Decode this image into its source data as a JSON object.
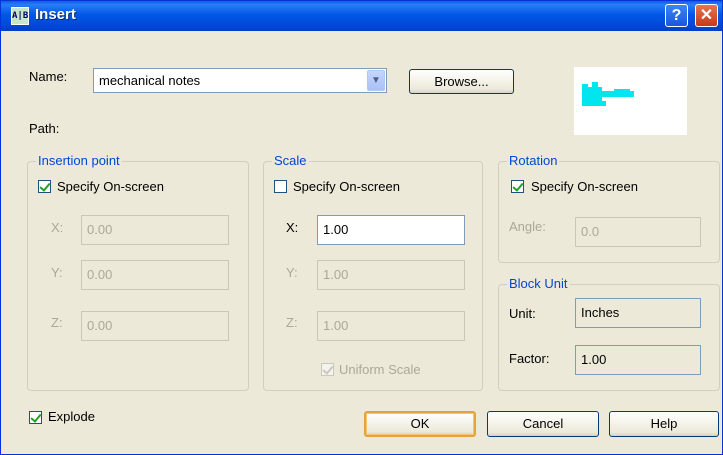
{
  "window": {
    "title": "Insert",
    "help_glyph": "?",
    "close_glyph": "✕",
    "icon_text": "A|B"
  },
  "name_row": {
    "label": "Name:",
    "value": "mechanical notes",
    "browse_label": "Browse..."
  },
  "path": {
    "label": "Path:"
  },
  "insertion_point": {
    "title": "Insertion point",
    "specify_label": "Specify On-screen",
    "specify_checked": true,
    "x_label": "X:",
    "x_value": "0.00",
    "y_label": "Y:",
    "y_value": "0.00",
    "z_label": "Z:",
    "z_value": "0.00"
  },
  "scale": {
    "title": "Scale",
    "specify_label": "Specify On-screen",
    "specify_checked": false,
    "x_label": "X:",
    "x_value": "1.00",
    "y_label": "Y:",
    "y_value": "1.00",
    "z_label": "Z:",
    "z_value": "1.00",
    "uniform_label": "Uniform Scale",
    "uniform_checked": true
  },
  "rotation": {
    "title": "Rotation",
    "specify_label": "Specify On-screen",
    "specify_checked": true,
    "angle_label": "Angle:",
    "angle_value": "0.0"
  },
  "block_unit": {
    "title": "Block Unit",
    "unit_label": "Unit:",
    "unit_value": "Inches",
    "factor_label": "Factor:",
    "factor_value": "1.00"
  },
  "explode": {
    "label": "Explode",
    "checked": true
  },
  "buttons": {
    "ok": "OK",
    "cancel": "Cancel",
    "help": "Help"
  },
  "colors": {
    "title_bar": "#0058e6",
    "group_title": "#0046d5",
    "preview_symbol": "#00e5ee"
  }
}
